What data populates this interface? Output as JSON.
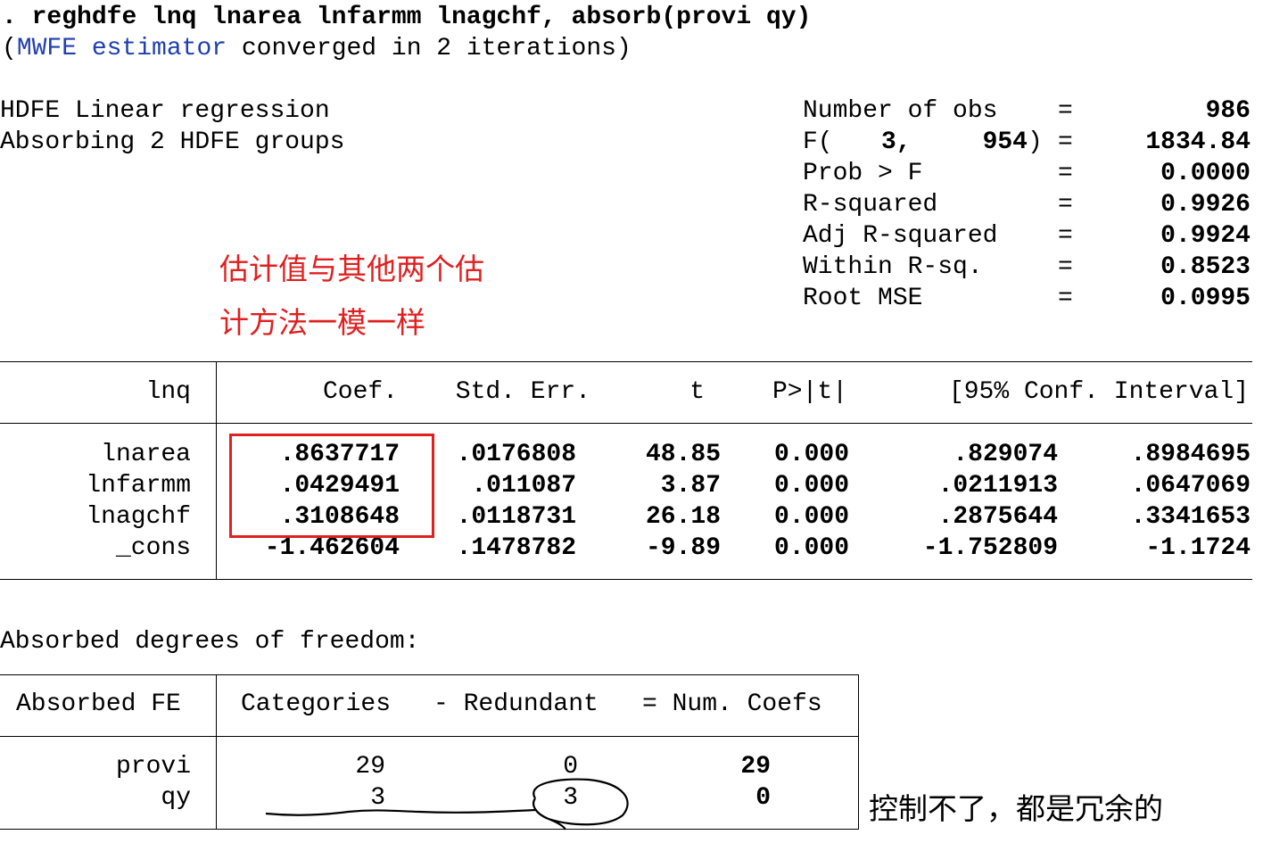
{
  "command": {
    "prefix": ".",
    "text": "reghdfe lnq lnarea lnfarmm lnagchf, absorb(provi qy)"
  },
  "convergence": {
    "open": "(",
    "estimator": "MWFE estimator",
    "rest": "converged in 2 iterations)"
  },
  "header": {
    "title_line1": "HDFE Linear regression",
    "title_line2": "Absorbing 2 HDFE groups",
    "stats": [
      {
        "label": "Number of obs",
        "eq": "=",
        "value": "986"
      },
      {
        "label": "F(",
        "df1": "3,",
        "df2": "954",
        "close": ")",
        "eq": "=",
        "value": "1834.84"
      },
      {
        "label": "Prob > F",
        "eq": "=",
        "value": "0.0000"
      },
      {
        "label": "R-squared",
        "eq": "=",
        "value": "0.9926"
      },
      {
        "label": "Adj R-squared",
        "eq": "=",
        "value": "0.9924"
      },
      {
        "label": "Within R-sq.",
        "eq": "=",
        "value": "0.8523"
      },
      {
        "label": "Root MSE",
        "eq": "=",
        "value": "0.0995"
      }
    ]
  },
  "annotations": {
    "red_line1": "估计值与其他两个估",
    "red_line2": "计方法一模一样",
    "black_note": "控制不了，都是冗余的",
    "colors": {
      "red": "#e02020",
      "blue": "#1f3fb0"
    }
  },
  "coef_table": {
    "depvar": "lnq",
    "headers": [
      "Coef.",
      "Std. Err.",
      "t",
      "P>|t|",
      "[95% Conf. Interval]"
    ],
    "rows": [
      {
        "name": "lnarea",
        "coef": ".8637717",
        "se": ".0176808",
        "t": "48.85",
        "p": "0.000",
        "lo": ".829074",
        "hi": ".8984695"
      },
      {
        "name": "lnfarmm",
        "coef": ".0429491",
        "se": ".011087",
        "t": "3.87",
        "p": "0.000",
        "lo": ".0211913",
        "hi": ".0647069"
      },
      {
        "name": "lnagchf",
        "coef": ".3108648",
        "se": ".0118731",
        "t": "26.18",
        "p": "0.000",
        "lo": ".2875644",
        "hi": ".3341653"
      },
      {
        "name": "_cons",
        "coef": "-1.462604",
        "se": ".1478782",
        "t": "-9.89",
        "p": "0.000",
        "lo": "-1.752809",
        "hi": "-1.1724"
      }
    ]
  },
  "absorbed": {
    "title": "Absorbed degrees of freedom:",
    "headers": [
      "Absorbed FE",
      "Categories",
      "- Redundant",
      "= Num. Coefs"
    ],
    "rows": [
      {
        "name": "provi",
        "categories": "29",
        "redundant": "0",
        "num": "29"
      },
      {
        "name": "qy",
        "categories": "3",
        "redundant": "3",
        "num": "0"
      }
    ]
  }
}
